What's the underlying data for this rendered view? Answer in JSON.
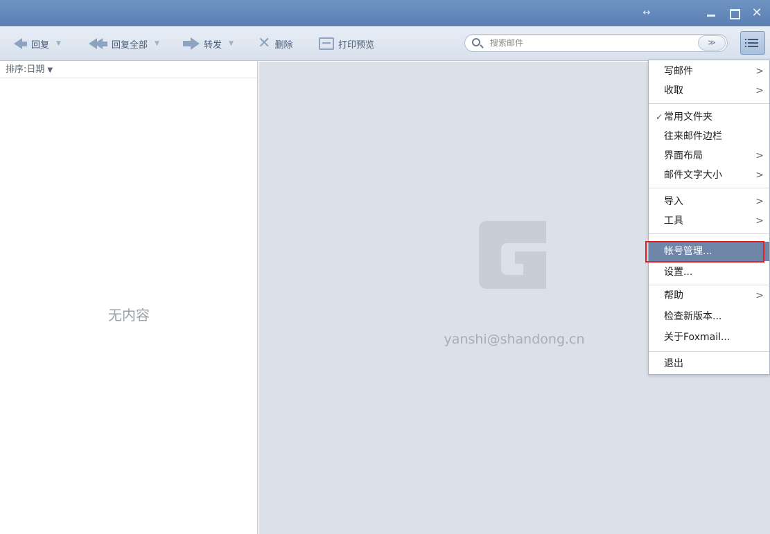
{
  "toolbar": {
    "reply": "回复",
    "reply_all": "回复全部",
    "forward": "转发",
    "delete": "删除",
    "print_preview": "打印预览",
    "search_placeholder": "搜索邮件",
    "search_options": "≫"
  },
  "list_pane": {
    "sort_label": "排序:日期",
    "empty_text": "无内容"
  },
  "reading_pane": {
    "account_email": "yanshi@shandong.cn"
  },
  "menu": {
    "items": [
      {
        "label": "写邮件",
        "submenu": ">"
      },
      {
        "label": "收取",
        "submenu": ">"
      },
      {
        "label": "常用文件夹",
        "checked": "✓"
      },
      {
        "label": "往来邮件边栏"
      },
      {
        "label": "界面布局",
        "submenu": ">"
      },
      {
        "label": "邮件文字大小",
        "submenu": ">"
      },
      {
        "label": "导入",
        "submenu": ">"
      },
      {
        "label": "工具",
        "submenu": ">"
      },
      {
        "label": "帐号管理..."
      },
      {
        "label": "设置..."
      },
      {
        "label": "帮助",
        "submenu": ">"
      },
      {
        "label": "检查新版本..."
      },
      {
        "label": "关于Foxmail..."
      },
      {
        "label": "退出"
      }
    ]
  },
  "colors": {
    "titlebar": "#5b7fb1",
    "menu_highlight": "#6f86a8",
    "annotation_box": "#e02020"
  }
}
